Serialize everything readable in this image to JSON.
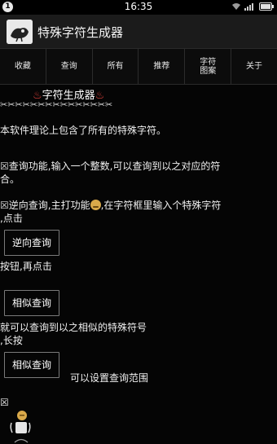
{
  "status_bar": {
    "notification_count": "1",
    "time": "16:35",
    "icons": [
      "wifi-icon",
      "signal-icon",
      "battery-icon"
    ]
  },
  "app_bar": {
    "title": "特殊字符生成器",
    "icon": "app-logo-icon"
  },
  "tabs": [
    {
      "label": "收藏"
    },
    {
      "label": "查询"
    },
    {
      "label": "所有"
    },
    {
      "label": "推荐"
    },
    {
      "label": "字符\n图案"
    },
    {
      "label": "关于"
    }
  ],
  "content": {
    "heading_deco_left": "♨",
    "heading_text": "字符生成器",
    "heading_deco_right": "♨",
    "scissors_row": "✂✂✂✂✂✂✂✂✂✂✂✂✂✂✂",
    "intro": "本软件理论上包含了所有的特殊字符。",
    "box_mark": "☒",
    "query_line1": "查询功能,输入一个整数,可以查询到以之对应的符",
    "query_line2": "合。",
    "reverse_line1_a": "逆向查询,主打功能",
    "reverse_line1_b": ",在字符框里输入个特殊字符",
    "reverse_line2": ",点击",
    "reverse_button": "逆向查询",
    "after_reverse": "按钮,再点击",
    "similar_button": "相似查询",
    "after_similar_line1": "就可以查询到以之相似的特殊符号",
    "after_similar_line2": ",长按",
    "similar_button_2": "相似查询",
    "range_text": "可以设置查询范围",
    "bottom_box_mark": "☒"
  },
  "colors": {
    "background": "#050505",
    "app_bar": "#1b1b1b",
    "fire_accent": "#e0403a",
    "button_border": "#7a7a7a"
  }
}
